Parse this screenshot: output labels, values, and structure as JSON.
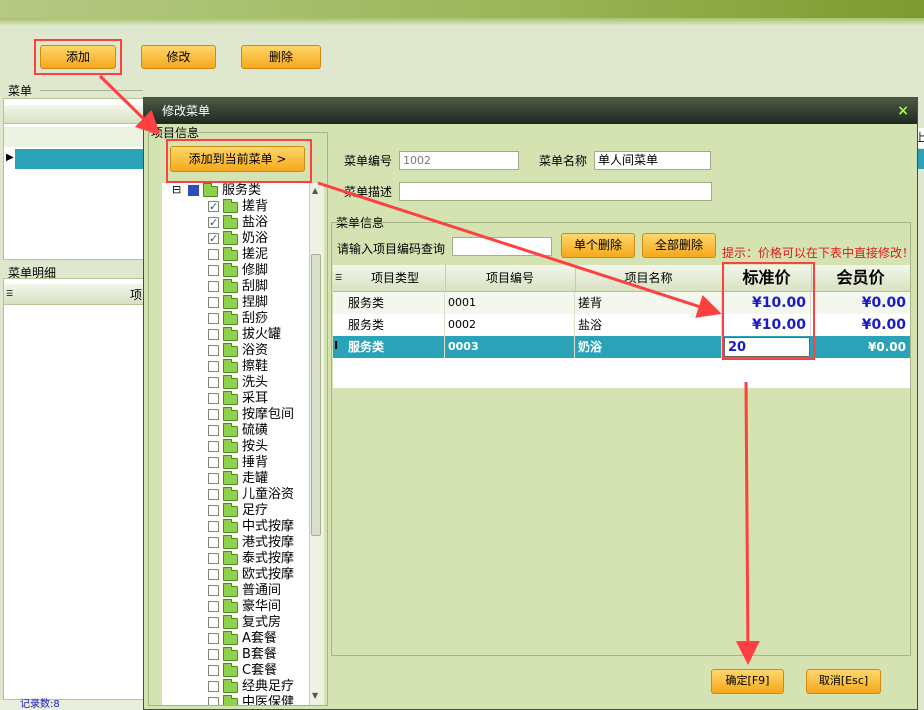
{
  "toolbar": {
    "add": "添加",
    "edit": "修改",
    "delete": "删除"
  },
  "main": {
    "menu_group": "菜单",
    "menu_detail_group": "菜单明细",
    "detail_col": "项",
    "record_count": "记录数:8",
    "right_col": "止"
  },
  "dialog": {
    "title": "修改菜单",
    "close": "×",
    "item_info_group": "项目信息",
    "add_to_menu": "添加到当前菜单 >",
    "menu_no_label": "菜单编号",
    "menu_no_value": "1002",
    "menu_name_label": "菜单名称",
    "menu_name_value": "单人间菜单",
    "menu_desc_label": "菜单描述",
    "menu_desc_value": "",
    "menu_info_group": "菜单信息",
    "query_label": "请输入项目编码查询",
    "query_value": "",
    "delete_single": "单个删除",
    "delete_all": "全部删除",
    "hint": "提示：价格可以在下表中直接修改！",
    "confirm": "确定[F9]",
    "cancel": "取消[Esc]"
  },
  "tree": {
    "root": "服务类",
    "items": [
      {
        "label": "搓背",
        "checked": true
      },
      {
        "label": "盐浴",
        "checked": true
      },
      {
        "label": "奶浴",
        "checked": true
      },
      {
        "label": "搓泥",
        "checked": false
      },
      {
        "label": "修脚",
        "checked": false
      },
      {
        "label": "刮脚",
        "checked": false
      },
      {
        "label": "捏脚",
        "checked": false
      },
      {
        "label": "刮痧",
        "checked": false
      },
      {
        "label": "拔火罐",
        "checked": false
      },
      {
        "label": "浴资",
        "checked": false
      },
      {
        "label": "擦鞋",
        "checked": false
      },
      {
        "label": "洗头",
        "checked": false
      },
      {
        "label": "采耳",
        "checked": false
      },
      {
        "label": "按摩包间",
        "checked": false
      },
      {
        "label": "硫磺",
        "checked": false
      },
      {
        "label": "按头",
        "checked": false
      },
      {
        "label": "捶背",
        "checked": false
      },
      {
        "label": "走罐",
        "checked": false
      },
      {
        "label": "儿童浴资",
        "checked": false
      },
      {
        "label": "足疗",
        "checked": false
      },
      {
        "label": "中式按摩",
        "checked": false
      },
      {
        "label": "港式按摩",
        "checked": false
      },
      {
        "label": "泰式按摩",
        "checked": false
      },
      {
        "label": "欧式按摩",
        "checked": false
      },
      {
        "label": "普通间",
        "checked": false
      },
      {
        "label": "豪华间",
        "checked": false
      },
      {
        "label": "复式房",
        "checked": false
      },
      {
        "label": "A套餐",
        "checked": false
      },
      {
        "label": "B套餐",
        "checked": false
      },
      {
        "label": "C套餐",
        "checked": false
      },
      {
        "label": "经典足疗",
        "checked": false
      },
      {
        "label": "中医保健",
        "checked": false
      }
    ]
  },
  "table": {
    "columns": [
      "项目类型",
      "项目编号",
      "项目名称",
      "标准价",
      "会员价"
    ],
    "rows": [
      {
        "type": "服务类",
        "code": "0001",
        "name": "搓背",
        "std": "¥10.00",
        "member": "¥0.00"
      },
      {
        "type": "服务类",
        "code": "0002",
        "name": "盐浴",
        "std": "¥10.00",
        "member": "¥0.00"
      },
      {
        "type": "服务类",
        "code": "0003",
        "name": "奶浴",
        "std": "20",
        "member": "¥0.00"
      }
    ]
  },
  "colors": {
    "accent_orange": "#f5a81c",
    "selected_row": "#2aa3b8",
    "hint_red": "#e01818",
    "price_blue": "#1a1ac8",
    "callout_red": "#ff4040"
  }
}
